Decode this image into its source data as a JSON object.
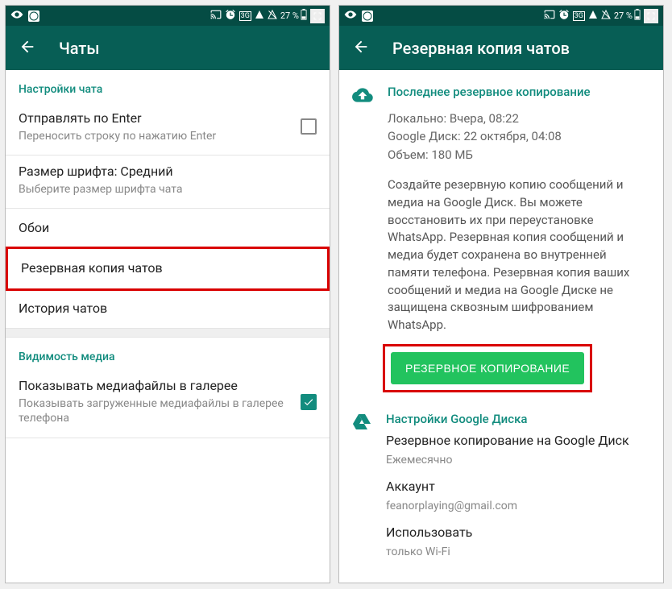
{
  "status": {
    "battery_pct": "27 %",
    "network": "3G"
  },
  "left": {
    "title": "Чаты",
    "section_chat": "Настройки чата",
    "enter_send_title": "Отправлять по Enter",
    "enter_send_sub": "Переносить строку по нажатию Enter",
    "font_title": "Размер шрифта: Средний",
    "font_sub": "Выберите размер шрифта чата",
    "wallpaper": "Обои",
    "backup": "Резервная копия чатов",
    "history": "История чатов",
    "section_media": "Видимость медиа",
    "media_title": "Показывать медиафайлы в галерее",
    "media_sub": "Показывать загруженные медиафайлы в галерее телефона"
  },
  "right": {
    "title": "Резервная копия чатов",
    "last_backup_header": "Последнее резервное копирование",
    "local_line": "Локально: Вчера, 08:22",
    "gdrive_line": "Google Диск: 22 октября, 04:08",
    "size_line": "Объем: 180 МБ",
    "description": "Создайте резервную копию сообщений и медиа на Google Диск. Вы можете восстановить их при переустановке WhatsApp. Резервная копия сообщений и медиа будет сохранена во внутренней памяти телефона. Резервная копия ваших сообщений и медиа на Google Диске не защищена сквозным шифрованием WhatsApp.",
    "backup_button": "РЕЗЕРВНОЕ КОПИРОВАНИЕ",
    "drive_header": "Настройки Google Диска",
    "drive_backup_title": "Резервное копирование на Google Диск",
    "drive_backup_value": "Ежемесячно",
    "account_title": "Аккаунт",
    "account_value": "feanorplaying@gmail.com",
    "use_title": "Использовать",
    "use_value": "только Wi-Fi"
  }
}
